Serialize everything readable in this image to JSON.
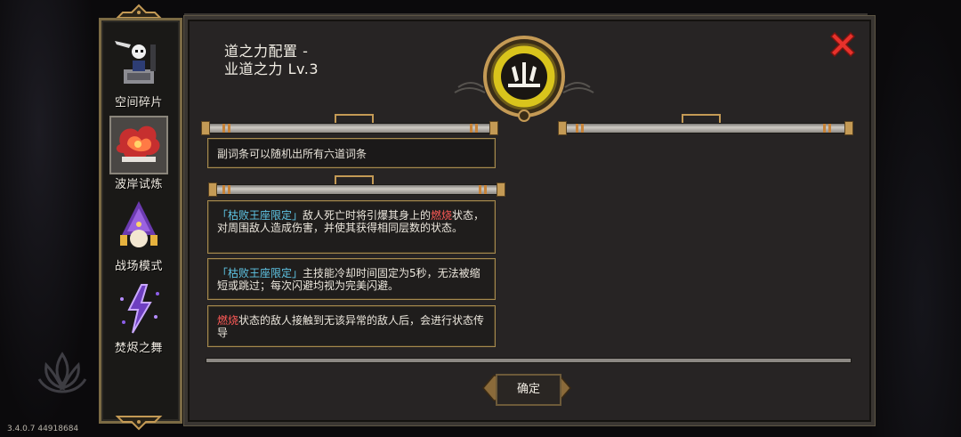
{
  "version": "3.4.0.7 44918684",
  "sidebar": {
    "modes": [
      {
        "label": "空间碎片"
      },
      {
        "label": "波岸试炼"
      },
      {
        "label": "战场模式"
      },
      {
        "label": "焚烬之舞"
      }
    ]
  },
  "panel": {
    "title_line1": "道之力配置 -",
    "title_line2": "业道之力 Lv.3",
    "subtitle": "副词条可以随机出所有六道词条",
    "cards": [
      {
        "tag": "「枯败王座限定」",
        "text_before": "敌人死亡时将引爆其身上的",
        "keyword": "燃烧",
        "text_after": "状态，对周围敌人造成伤害，并使其获得相同层数的状态。"
      },
      {
        "tag": "「枯败王座限定」",
        "text": "主技能冷却时间固定为5秒，无法被缩短或跳过；每次闪避均视为完美闪避。"
      },
      {
        "keyword": "燃烧",
        "text": "状态的敌人接触到无该异常的敌人后，会进行状态传导"
      }
    ],
    "confirm_label": "确定"
  },
  "colors": {
    "accent_gold": "#c49a55",
    "tag_blue": "#5fc6e6",
    "keyword_red": "#ff5a57",
    "close_red": "#e8312b"
  }
}
